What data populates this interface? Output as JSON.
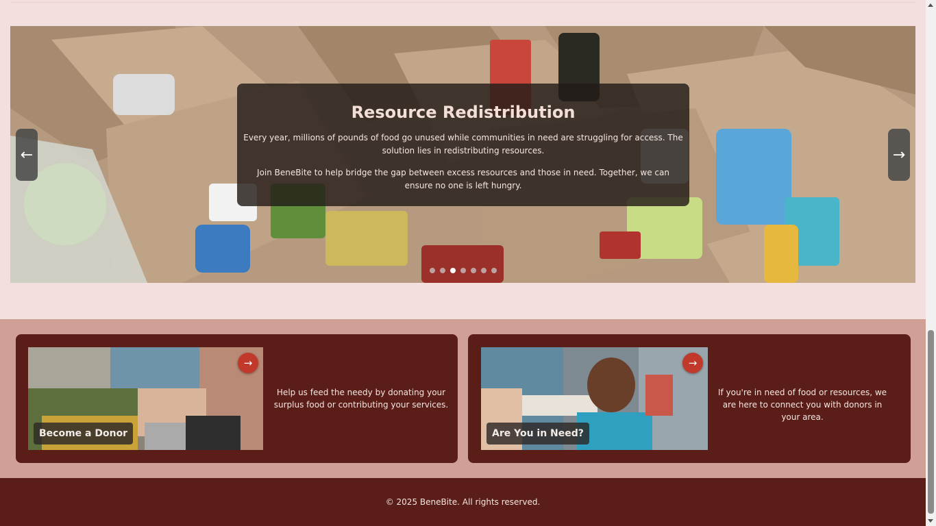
{
  "carousel": {
    "title": "Resource Redistribution",
    "paragraph_1": "Every year, millions of pounds of food go unused while communities in need are struggling for access. The solution lies in redistributing resources.",
    "paragraph_2": "Join BeneBite to help bridge the gap between excess resources and those in need. Together, we can ensure no one is left hungry.",
    "prev_icon": "arrow-left-icon",
    "next_icon": "arrow-right-icon",
    "prev_glyph": "←",
    "next_glyph": "→",
    "slide_count": 7,
    "active_slide": 3
  },
  "cards": [
    {
      "label": "Become a Donor",
      "text": "Help us feed the needy by donating your surplus food or contributing your services.",
      "arrow_glyph": "→"
    },
    {
      "label": "Are You in Need?",
      "text": "If you're in need of food or resources, we are here to connect you with donors in your area.",
      "arrow_glyph": "→"
    }
  ],
  "footer": {
    "copyright": "© 2025 BeneBite. All rights reserved."
  },
  "colors": {
    "page_bg": "#f3dfdd",
    "cards_section_bg": "#d09f95",
    "card_bg": "#5b1d18",
    "accent_red": "#c0392b",
    "footer_bg": "#5b1d18"
  }
}
